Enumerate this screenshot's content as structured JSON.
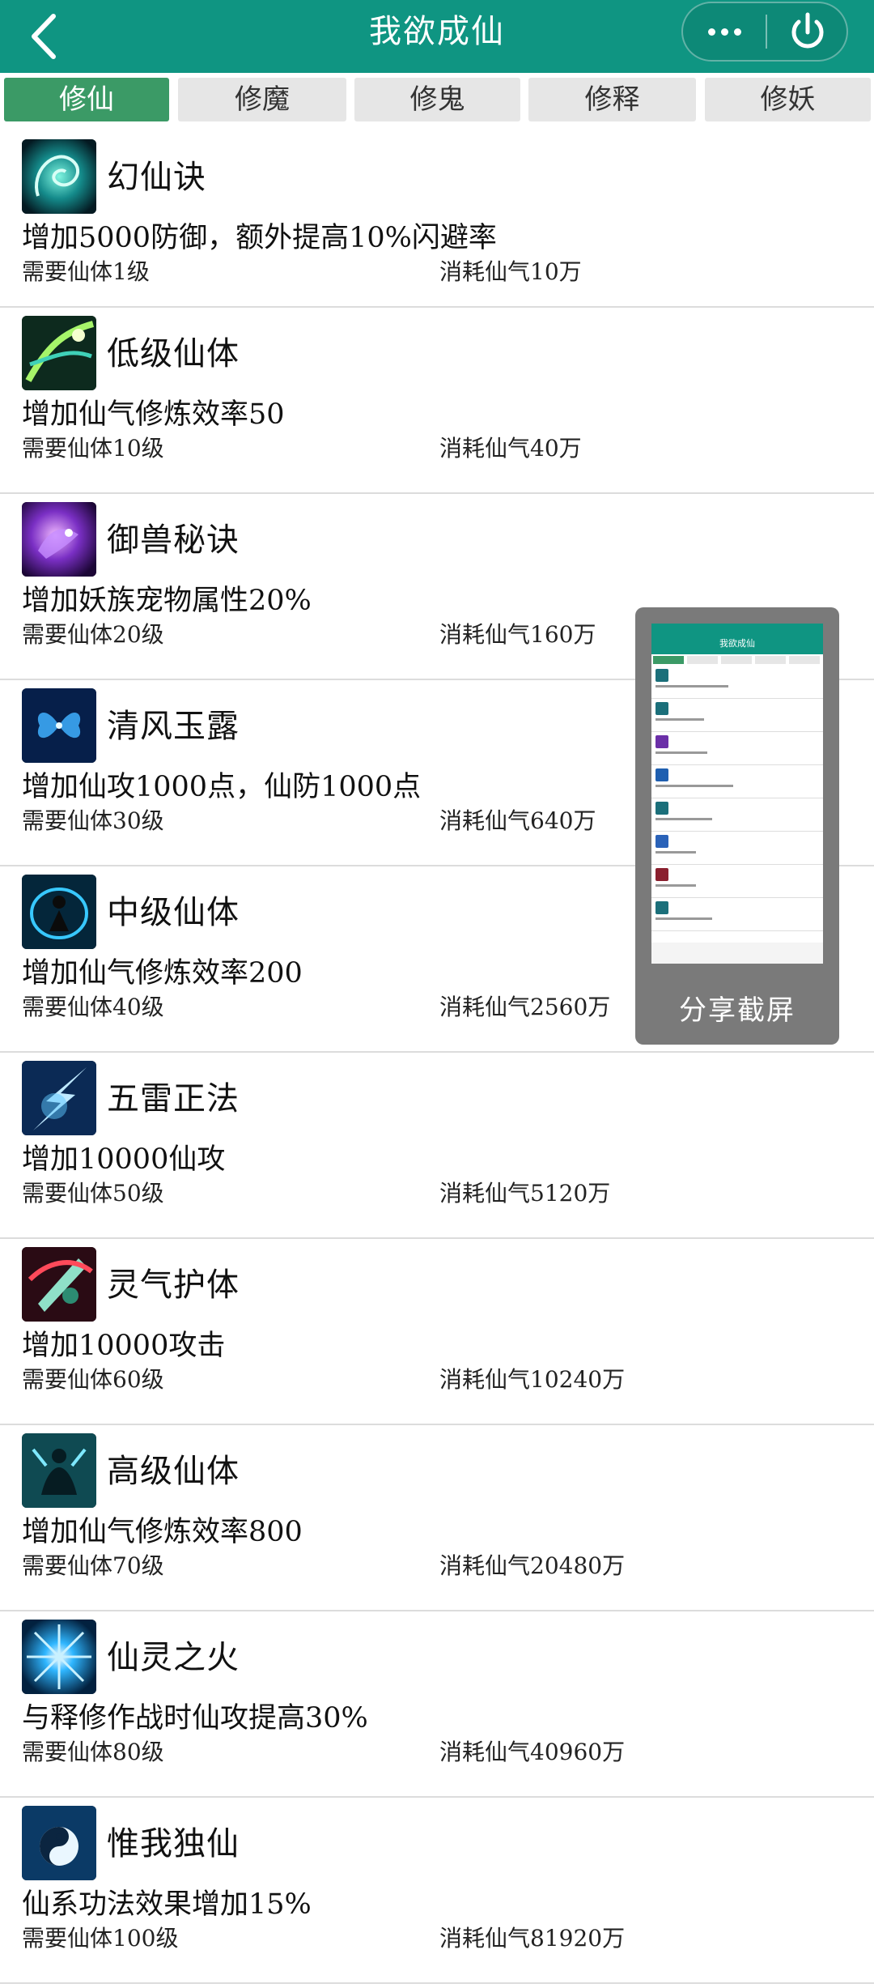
{
  "header": {
    "title": "我欲成仙"
  },
  "tabs": [
    {
      "label": "修仙",
      "active": true
    },
    {
      "label": "修魔",
      "active": false
    },
    {
      "label": "修鬼",
      "active": false
    },
    {
      "label": "修释",
      "active": false
    },
    {
      "label": "修妖",
      "active": false
    }
  ],
  "skills": [
    {
      "name": "幻仙诀",
      "desc": "增加5000防御，额外提高10%闪避率",
      "req": "需要仙体1级",
      "cost": "消耗仙气10万",
      "icon": "swirl-icon"
    },
    {
      "name": "低级仙体",
      "desc": "增加仙气修炼效率50",
      "req": "需要仙体10级",
      "cost": "消耗仙气40万",
      "icon": "leaf-icon"
    },
    {
      "name": "御兽秘诀",
      "desc": "增加妖族宠物属性20%",
      "req": "需要仙体20级",
      "cost": "消耗仙气160万",
      "icon": "beast-icon"
    },
    {
      "name": "清风玉露",
      "desc": "增加仙攻1000点，仙防1000点",
      "req": "需要仙体30级",
      "cost": "消耗仙气640万",
      "icon": "butterfly-icon"
    },
    {
      "name": "中级仙体",
      "desc": "增加仙气修炼效率200",
      "req": "需要仙体40级",
      "cost": "消耗仙气2560万",
      "icon": "figure-icon"
    },
    {
      "name": "五雷正法",
      "desc": "增加10000仙攻",
      "req": "需要仙体50级",
      "cost": "消耗仙气5120万",
      "icon": "thunder-icon"
    },
    {
      "name": "灵气护体",
      "desc": "增加10000攻击",
      "req": "需要仙体60级",
      "cost": "消耗仙气10240万",
      "icon": "shield-icon"
    },
    {
      "name": "高级仙体",
      "desc": "增加仙气修炼效率800",
      "req": "需要仙体70级",
      "cost": "消耗仙气20480万",
      "icon": "meditate-icon"
    },
    {
      "name": "仙灵之火",
      "desc": "与释修作战时仙攻提高30%",
      "req": "需要仙体80级",
      "cost": "消耗仙气40960万",
      "icon": "starburst-icon"
    },
    {
      "name": "惟我独仙",
      "desc": "仙系功法效果增加15%",
      "req": "需要仙体100级",
      "cost": "消耗仙气81920万",
      "icon": "yinyang-icon"
    }
  ],
  "share": {
    "label": "分享截屏",
    "thumb_title": "我欲成仙"
  },
  "colors": {
    "header": "#0f9582",
    "tab_active": "#3b9a66",
    "tab_inactive": "#e6e6e6"
  }
}
